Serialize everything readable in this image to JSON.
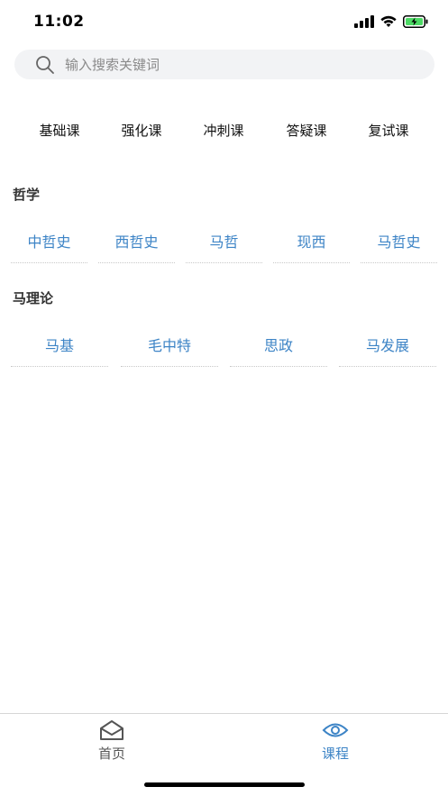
{
  "status_bar": {
    "time": "11:02"
  },
  "search": {
    "placeholder": "输入搜索关键词"
  },
  "course_tabs": [
    "基础课",
    "强化课",
    "冲刺课",
    "答疑课",
    "复试课"
  ],
  "sections": [
    {
      "title": "哲学",
      "items": [
        "中哲史",
        "西哲史",
        "马哲",
        "现西",
        "马哲史"
      ]
    },
    {
      "title": "马理论",
      "items": [
        "马基",
        "毛中特",
        "思政",
        "马发展"
      ]
    }
  ],
  "tabbar": {
    "items": [
      {
        "label": "首页",
        "icon": "home-icon",
        "active": false
      },
      {
        "label": "课程",
        "icon": "eye-icon",
        "active": true
      }
    ],
    "active_color": "#3d84c6",
    "inactive_color": "#555555"
  }
}
